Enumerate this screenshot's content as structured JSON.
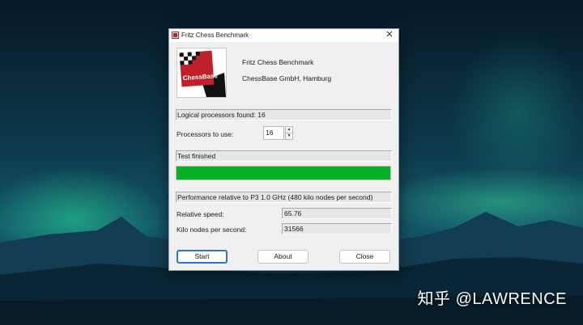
{
  "window": {
    "title": "Fritz Chess Benchmark",
    "close_glyph": "✕"
  },
  "about": {
    "product_name": "Fritz Chess Benchmark",
    "company": "ChessBase GmbH, Hamburg",
    "logo_text": "ChessBase"
  },
  "system": {
    "logical_processors": "Logical processors found: 16",
    "processors_label": "Processors to use:",
    "processors_value": "16",
    "spin_up": "▲",
    "spin_down": "▼"
  },
  "test": {
    "status": "Test finished",
    "progress_fraction": 1.0,
    "progress_color": "#06b025"
  },
  "results": {
    "reference": "Performance relative to P3 1.0 GHz (480 kilo nodes per second)",
    "relative_speed_label": "Relative speed:",
    "relative_speed_value": "65.76",
    "knps_label": "Kilo nodes per second:",
    "knps_value": "31566"
  },
  "buttons": {
    "start": "Start",
    "about": "About",
    "close": "Close"
  },
  "watermark": "知乎 @LAWRENCE",
  "colors": {
    "brand_red": "#c0202a",
    "focus_blue": "#2f74c8"
  }
}
